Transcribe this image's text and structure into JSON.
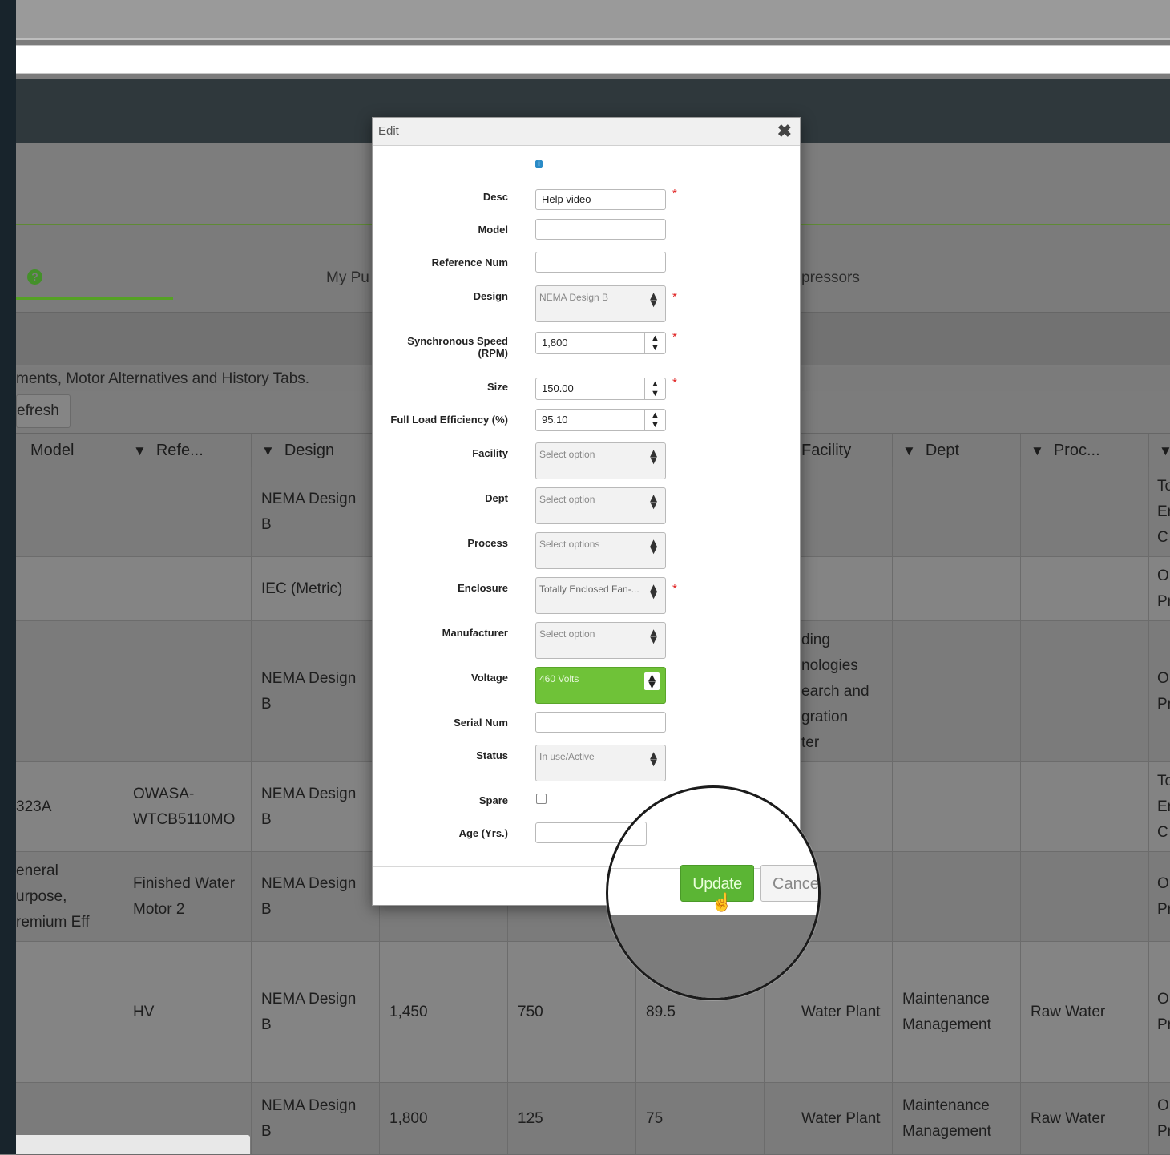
{
  "tabs": {
    "my_pumps": "My Pu",
    "compressors": "pressors"
  },
  "notice": "ments, Motor Alternatives and History Tabs.",
  "toolbar": {
    "refresh_label": "efresh"
  },
  "grid": {
    "headers": [
      "Model",
      "Refe...",
      "Design",
      "Facility",
      "Dept",
      "Proc..."
    ],
    "rows": [
      {
        "model": "",
        "ref": "",
        "design": "NEMA Design\nB",
        "c4": "",
        "c5": "",
        "c6": "",
        "facility": "",
        "dept": "",
        "proc": "",
        "last": "To\nEn\nC"
      },
      {
        "model": "",
        "ref": "",
        "design": "IEC (Metric)",
        "c4": "",
        "c5": "",
        "c6": "",
        "facility": "",
        "dept": "",
        "proc": "",
        "last": "O\nPr"
      },
      {
        "model": "",
        "ref": "",
        "design": "NEMA Design\nB",
        "c4": "",
        "c5": "",
        "c6": "",
        "facility": "ding\nnologies\nearch and\ngration\nter",
        "dept": "",
        "proc": "",
        "last": "O\nPr"
      },
      {
        "model": "323A",
        "ref": "OWASA-\nWTCB5110MO",
        "design": "NEMA Design\nB",
        "c4": "",
        "c5": "",
        "c6": "",
        "facility": "",
        "dept": "",
        "proc": "",
        "last": "To\nEn\nC"
      },
      {
        "model": "eneral\nurpose,\nremium Eff",
        "ref": "Finished Water\nMotor 2",
        "design": "NEMA Design\nB",
        "c4": "",
        "c5": "",
        "c6": "",
        "facility": "",
        "dept": "",
        "proc": "",
        "last": "O\nPr"
      },
      {
        "model": "",
        "ref": "HV",
        "design": "NEMA Design\nB",
        "c4": "1,450",
        "c5": "750",
        "c6": "89.5",
        "facility": "Water Plant",
        "dept": "Maintenance\nManagement",
        "proc": "Raw Water",
        "last": "O\nPr"
      },
      {
        "model": "",
        "ref": "",
        "design": "NEMA Design\nB",
        "c4": "1,800",
        "c5": "125",
        "c6": "75",
        "facility": "Water Plant",
        "dept": "Maintenance\nManagement",
        "proc": "Raw Water",
        "last": "O\nPr"
      }
    ]
  },
  "modal": {
    "title": "Edit",
    "close_glyph": "✖",
    "info_glyph": "i",
    "required_mark": "*",
    "fields": {
      "desc": {
        "label": "Desc",
        "value": "Help video"
      },
      "model": {
        "label": "Model",
        "value": ""
      },
      "reference_num": {
        "label": "Reference Num",
        "value": ""
      },
      "design": {
        "label": "Design",
        "value": "NEMA Design B"
      },
      "sync_speed": {
        "label": "Synchronous Speed (RPM)",
        "value": "1,800"
      },
      "size": {
        "label": "Size",
        "value": "150.00"
      },
      "full_load_eff": {
        "label": "Full Load Efficiency (%)",
        "value": "95.10"
      },
      "facility": {
        "label": "Facility",
        "value": "Select option"
      },
      "dept": {
        "label": "Dept",
        "value": "Select option"
      },
      "process": {
        "label": "Process",
        "value": "Select options"
      },
      "enclosure": {
        "label": "Enclosure",
        "value": "Totally Enclosed Fan-..."
      },
      "manufacturer": {
        "label": "Manufacturer",
        "value": "Select option"
      },
      "voltage": {
        "label": "Voltage",
        "value": "460 Volts"
      },
      "serial_num": {
        "label": "Serial Num",
        "value": ""
      },
      "status": {
        "label": "Status",
        "value": "In use/Active"
      },
      "spare": {
        "label": "Spare",
        "checked": false
      },
      "age": {
        "label": "Age (Yrs.)",
        "value": ""
      }
    },
    "update_label": "Update",
    "cancel_label": "Cance"
  },
  "colors": {
    "accent_green": "#6fc238",
    "required_red": "#e02020"
  }
}
